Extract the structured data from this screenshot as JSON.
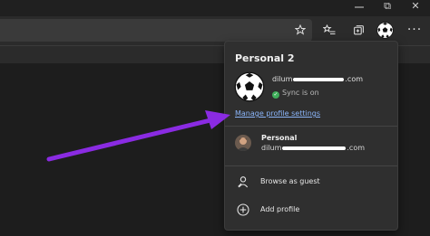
{
  "window": {
    "restore_glyph": "⧉",
    "close_glyph": "✕"
  },
  "toolbar": {
    "favorite_icon": "star-icon",
    "favorites_icon": "favorites-list-icon",
    "collections_icon": "collections-icon",
    "profile_icon": "soccer-ball-avatar-icon",
    "more_label": "···"
  },
  "profile_menu": {
    "title": "Personal 2",
    "primary_email_prefix": "dilum",
    "primary_email_suffix": ".com",
    "sync_status": "Sync is on",
    "manage_link": "Manage profile settings",
    "other_profile": {
      "name": "Personal",
      "email_prefix": "dilum",
      "email_suffix": ".com"
    },
    "actions": [
      {
        "label": "Browse as guest",
        "icon": "guest-icon"
      },
      {
        "label": "Add profile",
        "icon": "add-icon"
      }
    ]
  },
  "colors": {
    "link": "#8ab4f8",
    "sync_green": "#3fae5a",
    "annotation_arrow": "#8a2be2"
  }
}
